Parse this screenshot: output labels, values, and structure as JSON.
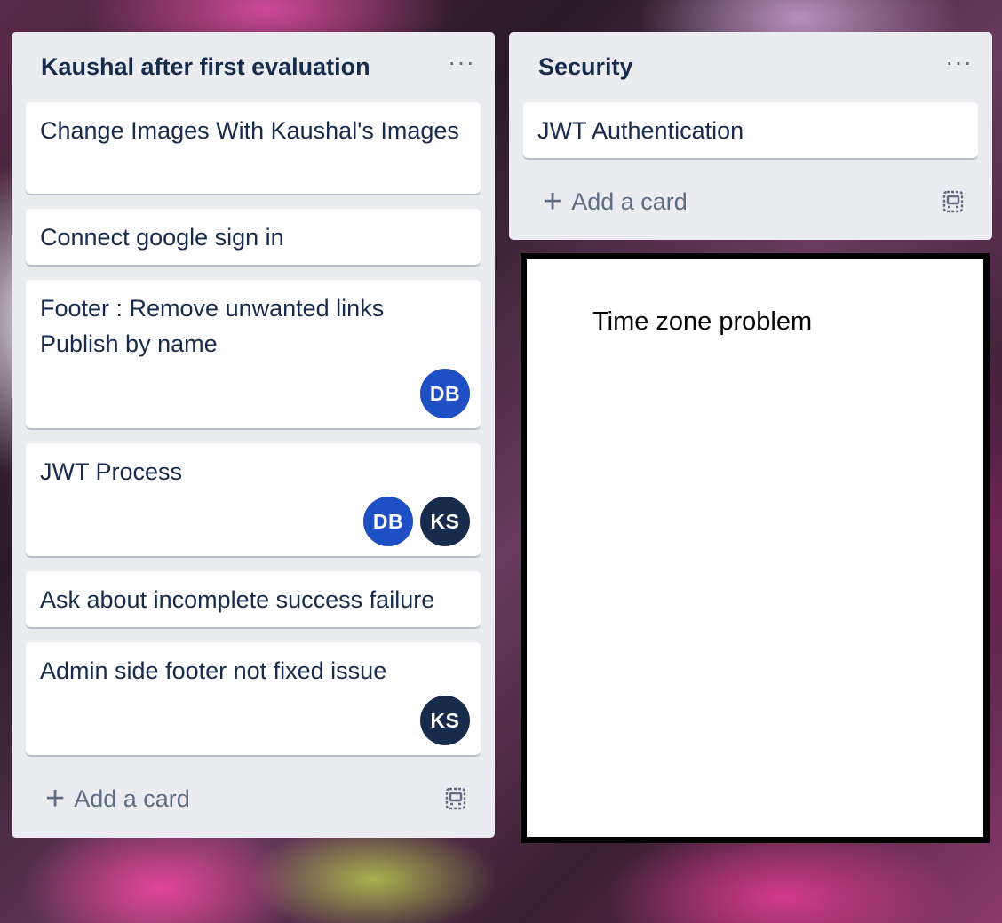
{
  "colors": {
    "list_bg": "#ebecf0",
    "card_bg": "#ffffff",
    "text": "#172b4d",
    "muted": "#5e6c84",
    "avatar_db": "#1f4fc4",
    "avatar_ks": "#172b4d"
  },
  "lists": [
    {
      "title": "Kaushal after first evaluation",
      "menu_icon": "ellipsis-icon",
      "cards": [
        {
          "text": "Change Images With Kaushal's Images",
          "members": []
        },
        {
          "text": "Connect google sign in",
          "members": []
        },
        {
          "text": "Footer : Remove unwanted links Publish by name",
          "members": [
            "DB"
          ]
        },
        {
          "text": "JWT Process",
          "members": [
            "DB",
            "KS"
          ]
        },
        {
          "text": "Ask about incomplete success failure",
          "members": []
        },
        {
          "text": "Admin side footer not fixed issue",
          "members": [
            "KS"
          ]
        }
      ],
      "add_card_label": "Add a card",
      "template_icon": "card-template-icon"
    },
    {
      "title": "Security",
      "menu_icon": "ellipsis-icon",
      "cards": [
        {
          "text": "JWT Authentication",
          "members": []
        }
      ],
      "add_card_label": "Add a card",
      "template_icon": "card-template-icon"
    }
  ],
  "note": {
    "text": "Time zone problem"
  }
}
